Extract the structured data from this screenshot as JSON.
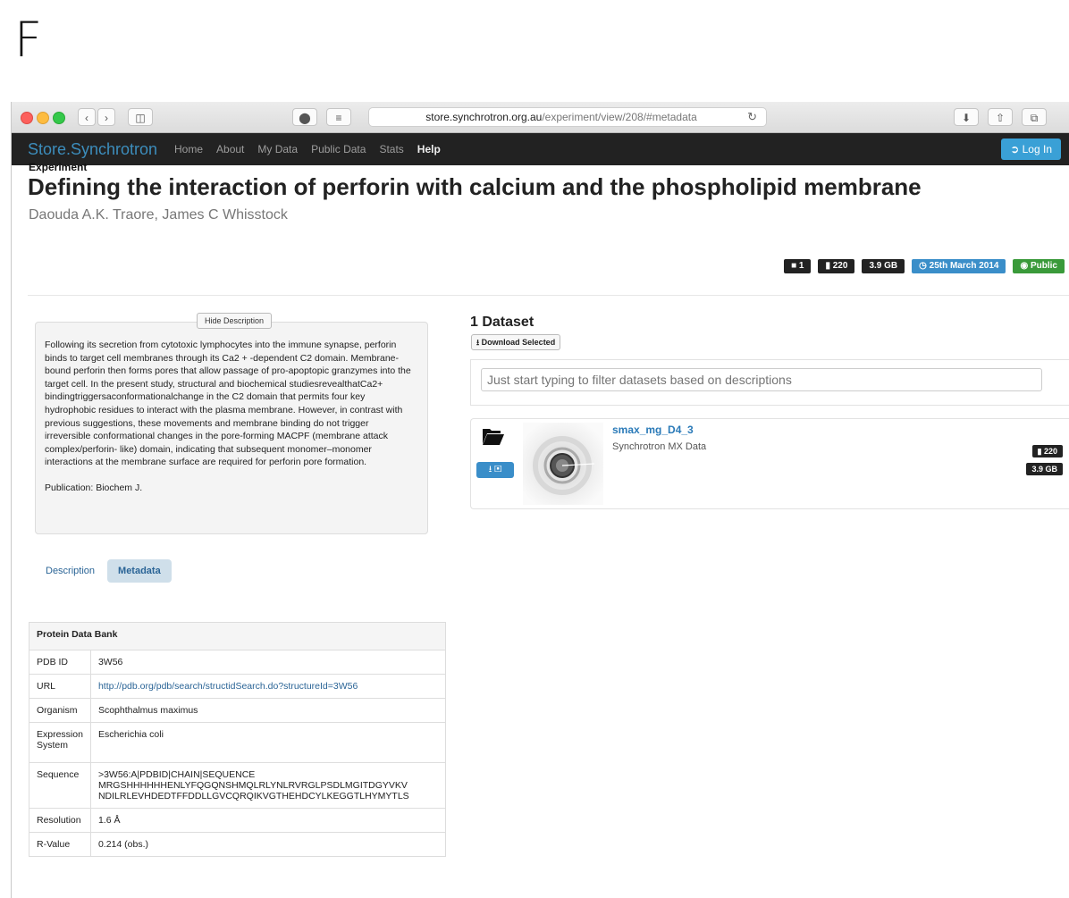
{
  "panel_letter": "F",
  "browser": {
    "url_host": "store.synchrotron.org.au",
    "url_path": "/experiment/view/208/#metadata"
  },
  "navbar": {
    "brand": "Store.Synchrotron",
    "links": [
      "Home",
      "About",
      "My Data",
      "Public Data",
      "Stats",
      "Help"
    ],
    "login": "Log In"
  },
  "experiment": {
    "label": "Experiment",
    "title": "Defining the interaction of perforin with calcium and the phospholipid membrane",
    "authors": "Daouda A.K. Traore, James C Whisstock",
    "badges": {
      "datasets": "1",
      "files": "220",
      "size": "3.9 GB",
      "date": "25th March 2014",
      "access": "Public"
    }
  },
  "description": {
    "toggle": "Hide Description",
    "text": "Following its secretion from cytotoxic lymphocytes into the immune synapse, perforin binds to target cell membranes through its Ca2 + -dependent C2 domain. Membrane-bound perforin then forms pores that allow passage of pro-apoptopic granzymes into the target cell. In the present study, structural and biochemical studiesrevealthatCa2+ bindingtriggersaconformationalchange in the C2 domain that permits four key hydrophobic residues to interact with the plasma membrane. However, in contrast with previous suggestions, these movements and membrane binding do not trigger irreversible conformational changes in the pore-forming MACPF (membrane attack complex/perforin- like) domain, indicating that subsequent monomer–monomer interactions at the membrane surface are required for perforin pore formation.",
    "publication": "Publication: Biochem J."
  },
  "tabs": [
    "Description",
    "Metadata"
  ],
  "metadata": {
    "section": "Protein Data Bank",
    "rows": [
      {
        "key": "PDB ID",
        "value": "3W56"
      },
      {
        "key": "URL",
        "value": "http://pdb.org/pdb/search/structidSearch.do?structureId=3W56"
      },
      {
        "key": "Organism",
        "value": "Scophthalmus maximus"
      },
      {
        "key": "Expression System",
        "value": "Escherichia coli"
      },
      {
        "key": "Sequence",
        "value1": ">3W56:A|PDBID|CHAIN|SEQUENCE",
        "value2": "MRGSHHHHHHENLYFQGQNSHMQLRLYNLRVRGLPSDLMGITDGYVKV",
        "value3": "NDILRLEVHDEDTFFDDLLGVCQRQIKVGTHEHDCYLKEGGTLHYMYTLS"
      },
      {
        "key": "Resolution",
        "value": "1.6 Å"
      },
      {
        "key": "R-Value",
        "value": "0.214 (obs.)"
      }
    ]
  },
  "datasets": {
    "heading": "1 Dataset",
    "download_selected": "Download Selected",
    "filter_placeholder": "Just start typing to filter datasets based on descriptions",
    "items": [
      {
        "name": "smax_mg_D4_3",
        "type": "Synchrotron MX Data",
        "files": "220",
        "size": "3.9 GB"
      }
    ]
  }
}
